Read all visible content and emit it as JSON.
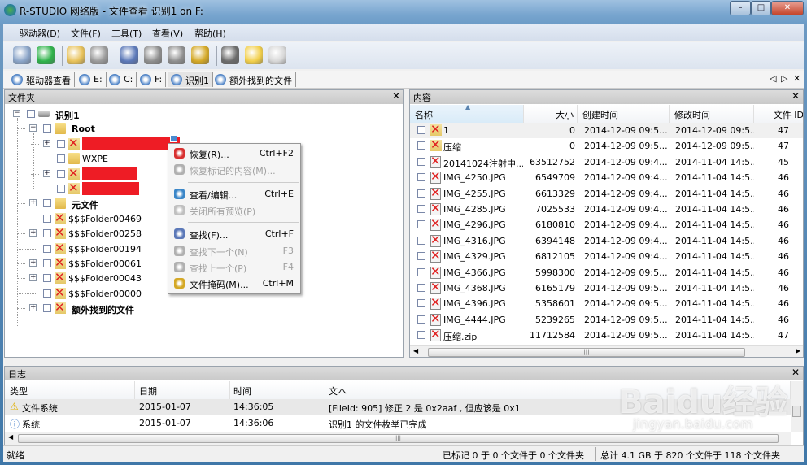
{
  "window": {
    "title": "R-STUDIO 网络版 - 文件查看 识别1 on F:",
    "controls": [
      "–",
      "□",
      "✕"
    ]
  },
  "menu": [
    "驱动器(D)",
    "文件(F)",
    "工具(T)",
    "查看(V)",
    "帮助(H)"
  ],
  "toolbar": [
    {
      "name": "connect-drive-icon",
      "color": "#8aa4c8"
    },
    {
      "name": "refresh-icon",
      "color": "#2fb34a"
    },
    {
      "sep": true
    },
    {
      "name": "recover-icon",
      "color": "#e8c25a"
    },
    {
      "name": "recover-marked-icon",
      "color": "#9a9a9a"
    },
    {
      "sep": true
    },
    {
      "name": "find-icon",
      "color": "#5b78b8"
    },
    {
      "name": "find-next-icon",
      "color": "#8e8e8e"
    },
    {
      "name": "find-previous-icon",
      "color": "#8e8e8e"
    },
    {
      "name": "file-mask-icon",
      "color": "#d4a825"
    },
    {
      "sep": true
    },
    {
      "name": "stop-icon",
      "color": "#6b6b6b"
    },
    {
      "name": "folder-up-icon",
      "color": "#f2cf4a"
    },
    {
      "name": "preview-icon",
      "color": "#d8d8d8"
    }
  ],
  "tabs": [
    "驱动器查看",
    "E:",
    "C:",
    "F:",
    "识别1",
    "额外找到的文件"
  ],
  "active_tab": 4,
  "tab_nav": [
    "◁",
    "▷",
    "✕"
  ],
  "left_pane": {
    "title": "文件夹",
    "tree": [
      {
        "label": "识别1",
        "level": 0,
        "expander": "−",
        "icon": "drive",
        "bold": true
      },
      {
        "label": "Root",
        "level": 1,
        "expander": "−",
        "icon": "folder",
        "bold": true
      },
      {
        "label": "",
        "level": 2,
        "expander": "+",
        "icon": "deleted",
        "redacted": true
      },
      {
        "label": "WXPE",
        "level": 2,
        "expander": "",
        "icon": "folder"
      },
      {
        "label": "",
        "level": 2,
        "expander": "+",
        "icon": "deleted",
        "redacted": true
      },
      {
        "label": "",
        "level": 2,
        "expander": "",
        "icon": "deleted",
        "redacted": true
      },
      {
        "label": "元文件",
        "level": 1,
        "expander": "+",
        "icon": "folder",
        "bold": true
      },
      {
        "label": "$$$Folder00469",
        "level": 1,
        "expander": "",
        "icon": "deleted"
      },
      {
        "label": "$$$Folder00258",
        "level": 1,
        "expander": "+",
        "icon": "deleted"
      },
      {
        "label": "$$$Folder00194",
        "level": 1,
        "expander": "",
        "icon": "deleted"
      },
      {
        "label": "$$$Folder00061",
        "level": 1,
        "expander": "+",
        "icon": "deleted"
      },
      {
        "label": "$$$Folder00043",
        "level": 1,
        "expander": "+",
        "icon": "deleted"
      },
      {
        "label": "$$$Folder00000",
        "level": 1,
        "expander": "",
        "icon": "deleted"
      },
      {
        "label": "额外找到的文件",
        "level": 1,
        "expander": "+",
        "icon": "deleted",
        "bold": true
      }
    ]
  },
  "context_menu": [
    {
      "label": "恢复(R)...",
      "shortcut": "Ctrl+F2",
      "enabled": true,
      "icon": "recover-icon",
      "color": "#d83030"
    },
    {
      "label": "恢复标记的内容(M)...",
      "shortcut": "",
      "enabled": false,
      "icon": "recover-marked-icon",
      "color": "#b0b0b0"
    },
    {
      "sep": true
    },
    {
      "label": "查看/编辑...",
      "shortcut": "Ctrl+E",
      "enabled": true,
      "icon": "view-edit-icon",
      "color": "#3a86c8"
    },
    {
      "label": "关闭所有预览(P)",
      "shortcut": "",
      "enabled": false,
      "icon": "close-previews-icon",
      "color": "#c0c0c0"
    },
    {
      "sep": true
    },
    {
      "label": "查找(F)...",
      "shortcut": "Ctrl+F",
      "enabled": true,
      "icon": "find-icon",
      "color": "#5b78b8"
    },
    {
      "label": "查找下一个(N)",
      "shortcut": "F3",
      "enabled": false,
      "icon": "find-next-icon",
      "color": "#b0b0b0"
    },
    {
      "label": "查找上一个(P)",
      "shortcut": "F4",
      "enabled": false,
      "icon": "find-previous-icon",
      "color": "#b0b0b0"
    },
    {
      "label": "文件掩码(M)...",
      "shortcut": "Ctrl+M",
      "enabled": true,
      "icon": "file-mask-icon",
      "color": "#d4a825"
    }
  ],
  "right_pane": {
    "title": "内容",
    "columns": [
      "名称",
      "大小",
      "创建时间",
      "修改时间",
      "文件 ID"
    ],
    "rows": [
      {
        "name": "1",
        "size": "0",
        "created": "2014-12-09 09:5...",
        "modified": "2014-12-09 09:5...",
        "id": "47",
        "type": "folder"
      },
      {
        "name": "压缩",
        "size": "0",
        "created": "2014-12-09 09:5...",
        "modified": "2014-12-09 09:5...",
        "id": "47",
        "type": "folder"
      },
      {
        "name": "20141024注射中...",
        "size": "63512752",
        "created": "2014-12-09 09:4...",
        "modified": "2014-11-04 14:5...",
        "id": "45",
        "type": "file"
      },
      {
        "name": "IMG_4250.JPG",
        "size": "6549709",
        "created": "2014-12-09 09:4...",
        "modified": "2014-11-04 14:5...",
        "id": "46",
        "type": "file"
      },
      {
        "name": "IMG_4255.JPG",
        "size": "6613329",
        "created": "2014-12-09 09:4...",
        "modified": "2014-11-04 14:5...",
        "id": "46",
        "type": "file"
      },
      {
        "name": "IMG_4285.JPG",
        "size": "7025533",
        "created": "2014-12-09 09:4...",
        "modified": "2014-11-04 14:5...",
        "id": "46",
        "type": "file"
      },
      {
        "name": "IMG_4296.JPG",
        "size": "6180810",
        "created": "2014-12-09 09:4...",
        "modified": "2014-11-04 14:5...",
        "id": "46",
        "type": "file"
      },
      {
        "name": "IMG_4316.JPG",
        "size": "6394148",
        "created": "2014-12-09 09:4...",
        "modified": "2014-11-04 14:5...",
        "id": "46",
        "type": "file"
      },
      {
        "name": "IMG_4329.JPG",
        "size": "6812105",
        "created": "2014-12-09 09:4...",
        "modified": "2014-11-04 14:5...",
        "id": "46",
        "type": "file"
      },
      {
        "name": "IMG_4366.JPG",
        "size": "5998300",
        "created": "2014-12-09 09:5...",
        "modified": "2014-11-04 14:5...",
        "id": "46",
        "type": "file"
      },
      {
        "name": "IMG_4368.JPG",
        "size": "6165179",
        "created": "2014-12-09 09:5...",
        "modified": "2014-11-04 14:5...",
        "id": "46",
        "type": "file"
      },
      {
        "name": "IMG_4396.JPG",
        "size": "5358601",
        "created": "2014-12-09 09:5...",
        "modified": "2014-11-04 14:5...",
        "id": "46",
        "type": "file"
      },
      {
        "name": "IMG_4444.JPG",
        "size": "5239265",
        "created": "2014-12-09 09:5...",
        "modified": "2014-11-04 14:5...",
        "id": "46",
        "type": "file"
      },
      {
        "name": "压缩.zip",
        "size": "11712584",
        "created": "2014-12-09 09:5...",
        "modified": "2014-11-04 14:5...",
        "id": "47",
        "type": "file"
      }
    ]
  },
  "log": {
    "title": "日志",
    "columns": [
      "类型",
      "日期",
      "时间",
      "文本"
    ],
    "rows": [
      {
        "type": "文件系统",
        "icon": "warning-icon",
        "date": "2015-01-07",
        "time": "14:36:05",
        "text": "[FileId: 905] 修正 2 是 0x2aaf , 但应该是 0x1"
      },
      {
        "type": "系统",
        "icon": "info-icon",
        "date": "2015-01-07",
        "time": "14:36:06",
        "text": "识别1 的文件枚举已完成"
      }
    ]
  },
  "status": {
    "ready": "就绪",
    "marked": "已标记 0 于 0 个文件于 0 个文件夹",
    "total": "总计 4.1 GB 于 820 个文件于 118 个文件夹"
  },
  "watermark": {
    "logo": "Baidu经验",
    "url": "jingyan.baidu.com"
  }
}
